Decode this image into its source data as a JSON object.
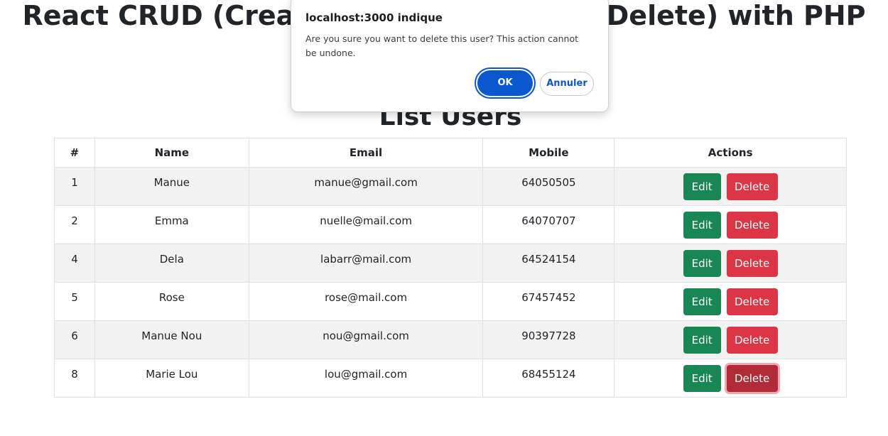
{
  "page": {
    "title": "React CRUD (Create Read Update and Delete) with PHP",
    "section_title": "List Users"
  },
  "table": {
    "headers": [
      "#",
      "Name",
      "Email",
      "Mobile",
      "Actions"
    ],
    "rows": [
      {
        "id": "1",
        "name": "Manue",
        "email": "manue@gmail.com",
        "mobile": "64050505"
      },
      {
        "id": "2",
        "name": "Emma",
        "email": "nuelle@mail.com",
        "mobile": "64070707"
      },
      {
        "id": "4",
        "name": "Dela",
        "email": "labarr@mail.com",
        "mobile": "64524154"
      },
      {
        "id": "5",
        "name": "Rose",
        "email": "rose@mail.com",
        "mobile": "67457452"
      },
      {
        "id": "6",
        "name": "Manue Nou",
        "email": "nou@gmail.com",
        "mobile": "90397728"
      },
      {
        "id": "8",
        "name": "Marie Lou",
        "email": "lou@gmail.com",
        "mobile": "68455124"
      }
    ],
    "edit_label": "Edit",
    "delete_label": "Delete"
  },
  "dialog": {
    "origin": "localhost:3000 indique",
    "message": "Are you sure you want to delete this user? This action cannot be undone.",
    "ok_label": "OK",
    "cancel_label": "Annuler"
  },
  "colors": {
    "edit_button": "#198754",
    "delete_button": "#dc3545",
    "dialog_primary": "#0b57d0"
  }
}
